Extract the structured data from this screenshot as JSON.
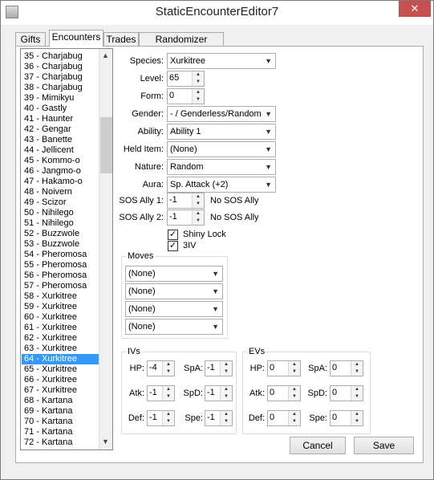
{
  "window": {
    "title": "StaticEncounterEditor7",
    "close_label": "✕"
  },
  "tabs": [
    {
      "label": "Gifts"
    },
    {
      "label": "Encounters"
    },
    {
      "label": "Trades"
    },
    {
      "label": "Randomizer Options"
    }
  ],
  "encounter_list": [
    "35 - Charjabug",
    "36 - Charjabug",
    "37 - Charjabug",
    "38 - Charjabug",
    "39 - Mimikyu",
    "40 - Gastly",
    "41 - Haunter",
    "42 - Gengar",
    "43 - Banette",
    "44 - Jellicent",
    "45 - Kommo-o",
    "46 - Jangmo-o",
    "47 - Hakamo-o",
    "48 - Noivern",
    "49 - Scizor",
    "50 - Nihilego",
    "51 - Nihilego",
    "52 - Buzzwole",
    "53 - Buzzwole",
    "54 - Pheromosa",
    "55 - Pheromosa",
    "56 - Pheromosa",
    "57 - Pheromosa",
    "58 - Xurkitree",
    "59 - Xurkitree",
    "60 - Xurkitree",
    "61 - Xurkitree",
    "62 - Xurkitree",
    "63 - Xurkitree",
    "64 - Xurkitree",
    "65 - Xurkitree",
    "66 - Xurkitree",
    "67 - Xurkitree",
    "68 - Kartana",
    "69 - Kartana",
    "70 - Kartana",
    "71 - Kartana",
    "72 - Kartana"
  ],
  "selected_index": 29,
  "form": {
    "species_label": "Species:",
    "species": "Xurkitree",
    "level_label": "Level:",
    "level": "65",
    "form_label": "Form:",
    "form": "0",
    "gender_label": "Gender:",
    "gender": "- / Genderless/Random",
    "ability_label": "Ability:",
    "ability": "Ability 1",
    "held_item_label": "Held Item:",
    "held_item": "(None)",
    "nature_label": "Nature:",
    "nature": "Random",
    "aura_label": "Aura:",
    "aura": "Sp. Attack (+2)",
    "sos1_label": "SOS Ally 1:",
    "sos1": "-1",
    "sos1_desc": "No SOS Ally",
    "sos2_label": "SOS Ally 2:",
    "sos2": "-1",
    "sos2_desc": "No SOS Ally",
    "shiny_lock_label": "Shiny Lock",
    "shiny_lock": true,
    "three_iv_label": "3IV",
    "three_iv": true
  },
  "moves": {
    "title": "Moves",
    "values": [
      "(None)",
      "(None)",
      "(None)",
      "(None)"
    ]
  },
  "ivs": {
    "title": "IVs",
    "hp_label": "HP:",
    "hp": "-4",
    "atk_label": "Atk:",
    "atk": "-1",
    "def_label": "Def:",
    "def": "-1",
    "spa_label": "SpA:",
    "spa": "-1",
    "spd_label": "SpD:",
    "spd": "-1",
    "spe_label": "Spe:",
    "spe": "-1"
  },
  "evs": {
    "title": "EVs",
    "hp_label": "HP:",
    "hp": "0",
    "atk_label": "Atk:",
    "atk": "0",
    "def_label": "Def:",
    "def": "0",
    "spa_label": "SpA:",
    "spa": "0",
    "spd_label": "SpD:",
    "spd": "0",
    "spe_label": "Spe:",
    "spe": "0"
  },
  "buttons": {
    "cancel": "Cancel",
    "save": "Save"
  },
  "colors": {
    "selection": "#3399ff",
    "close": "#c75050"
  }
}
